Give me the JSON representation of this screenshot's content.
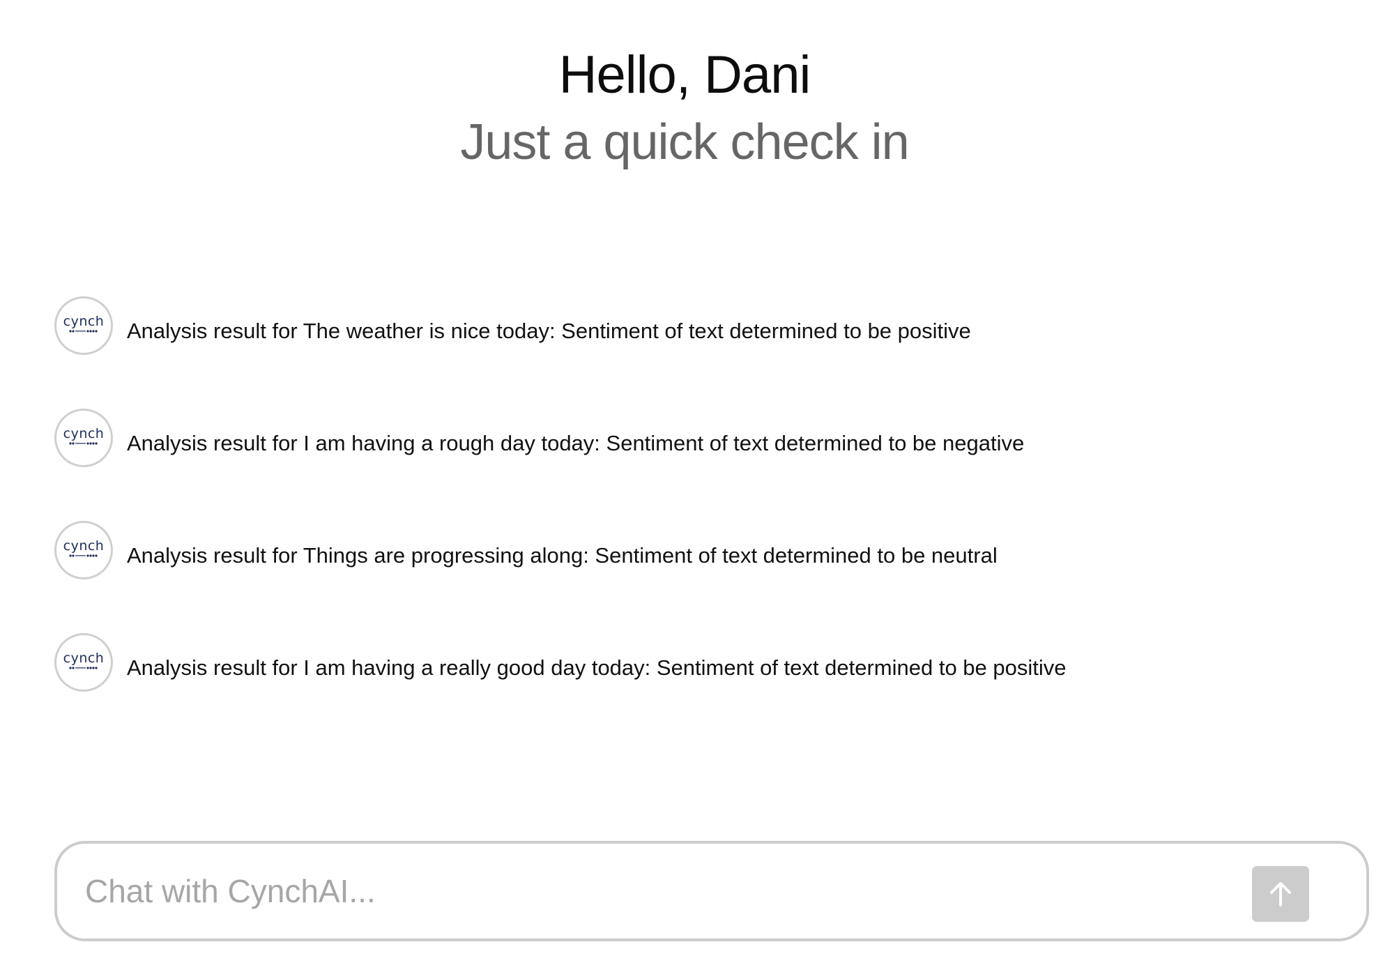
{
  "header": {
    "greeting": "Hello, Dani",
    "subtitle": "Just a quick check in"
  },
  "messages": [
    {
      "avatar_label": "cynch",
      "text": "Analysis result for The weather is nice today: Sentiment of text determined to be positive"
    },
    {
      "avatar_label": "cynch",
      "text": "Analysis result for I am having a rough day today: Sentiment of text determined to be negative"
    },
    {
      "avatar_label": "cynch",
      "text": "Analysis result for Things are progressing along: Sentiment of text determined to be neutral"
    },
    {
      "avatar_label": "cynch",
      "text": "Analysis result for I am having a really good day today: Sentiment of text determined to be positive"
    }
  ],
  "chat": {
    "placeholder": "Chat with CynchAI...",
    "value": "",
    "send_icon": "arrow-up-icon"
  },
  "colors": {
    "avatar_text": "#1f2d5a",
    "avatar_border": "#cfcfcf",
    "subtitle": "#666666",
    "input_border": "#cccccc",
    "send_button": "#cccccc"
  }
}
